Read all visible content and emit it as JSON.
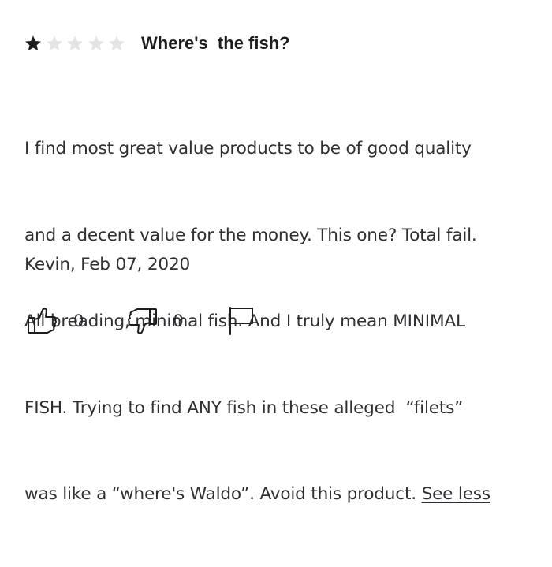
{
  "review": {
    "rating": 1,
    "rating_max": 5,
    "title": "Where's  the fish?",
    "body_lines": [
      "I find most great value products to be of good quality",
      "and a decent value for the money. This one? Total fail.",
      "All breading, minimal fish. And I truly mean MINIMAL",
      "FISH. Trying to find ANY fish in these alleged  “filets”",
      "was like a “where's Waldo”. Avoid this product. "
    ],
    "see_less_label": "See less",
    "author_date": "Kevin, Feb 07, 2020",
    "helpful_count": "0",
    "unhelpful_count": "0"
  },
  "colors": {
    "star_filled": "#1d1d1f",
    "star_empty": "#e3e4e5",
    "text": "#2e2f32"
  },
  "icons": {
    "thumbs_up": "thumbs-up-icon",
    "thumbs_down": "thumbs-down-icon",
    "report": "flag-icon"
  }
}
